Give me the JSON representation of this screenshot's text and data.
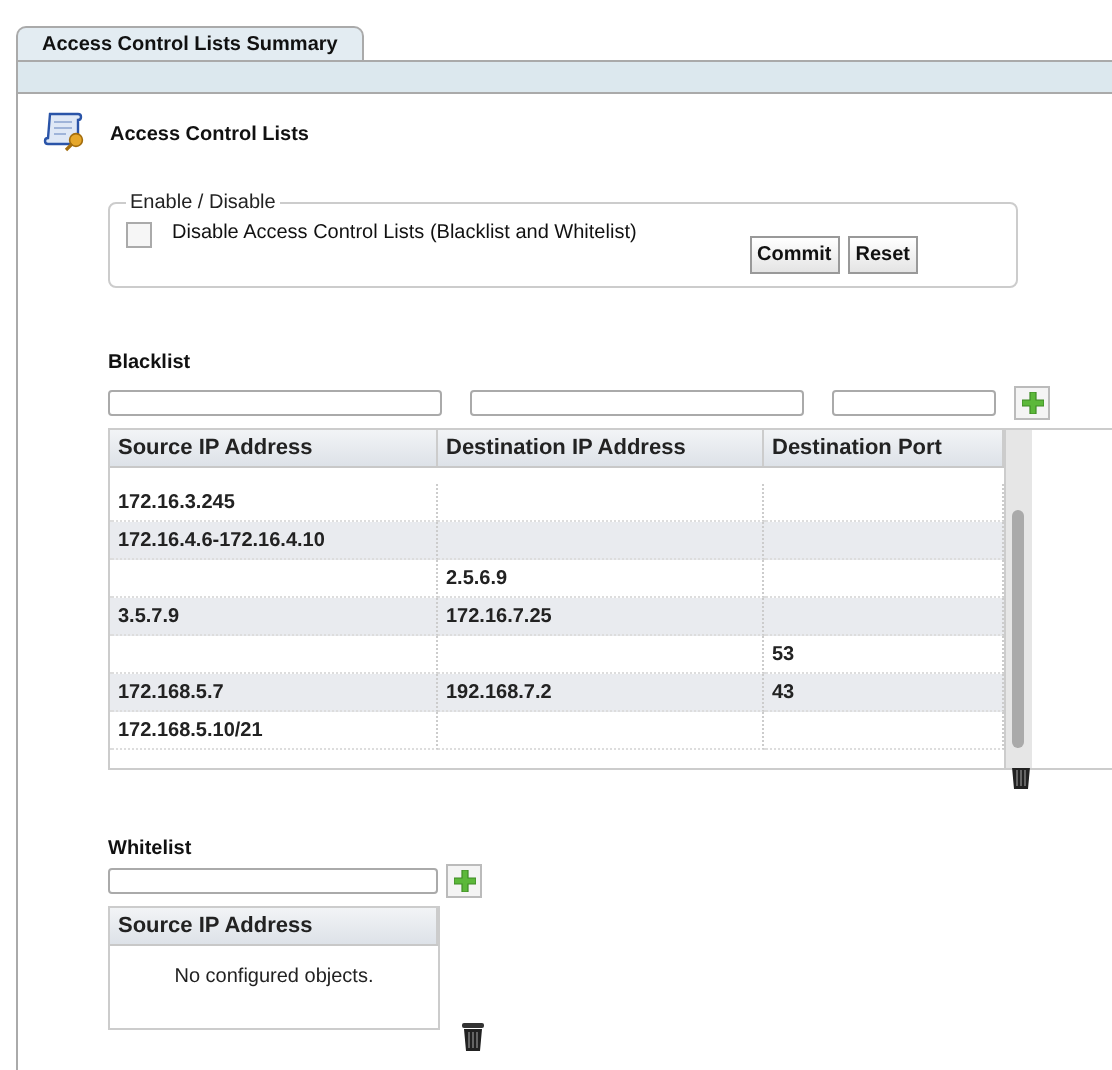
{
  "tabs": [
    {
      "label": "Access Control Lists Summary",
      "selected": true
    }
  ],
  "section_title": "Access Control Lists",
  "enable_disable": {
    "legend": "Enable / Disable",
    "checkbox": {
      "label": "Disable Access Control Lists (Blacklist and Whitelist)",
      "checked": false
    },
    "buttons": [
      "Commit",
      "Reset"
    ]
  },
  "blacklist": {
    "title": "Blacklist",
    "table": {
      "columns": [
        "Source IP Address",
        "Destination IP Address",
        "Destination Port"
      ],
      "rows": [
        [
          "172.16.3.245",
          "",
          ""
        ],
        [
          "172.16.4.6-172.16.4.10",
          "",
          ""
        ],
        [
          "",
          "2.5.6.9",
          ""
        ],
        [
          "3.5.7.9",
          "172.16.7.25",
          ""
        ],
        [
          "",
          "",
          "53"
        ],
        [
          "172.168.5.7",
          "192.168.7.2",
          "43"
        ],
        [
          "172.168.5.10/21",
          "",
          ""
        ]
      ]
    }
  },
  "whitelist": {
    "title": "Whitelist",
    "table": {
      "columns": [
        "Source IP Address"
      ],
      "empty_message": "No configured objects."
    }
  }
}
